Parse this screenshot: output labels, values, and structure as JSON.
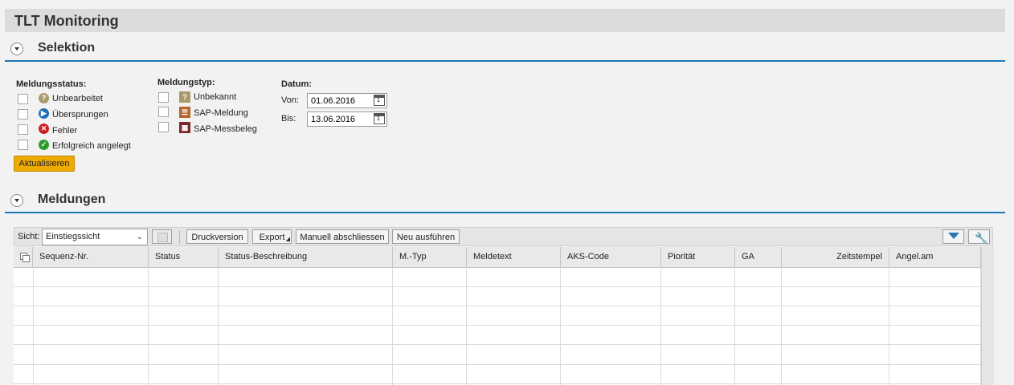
{
  "app": {
    "title": "TLT Monitoring"
  },
  "selektion": {
    "title": "Selektion",
    "status_group": {
      "title": "Meldungsstatus:",
      "options": [
        {
          "label": "Unbearbeitet",
          "icon": "question-icon"
        },
        {
          "label": "Übersprungen",
          "icon": "skip-icon"
        },
        {
          "label": "Fehler",
          "icon": "error-icon"
        },
        {
          "label": "Erfolgreich angelegt",
          "icon": "success-icon"
        }
      ]
    },
    "type_group": {
      "title": "Meldungstyp:",
      "options": [
        {
          "label": "Unbekannt",
          "icon": "question-icon"
        },
        {
          "label": "SAP-Meldung",
          "icon": "notification-icon"
        },
        {
          "label": "SAP-Messbeleg",
          "icon": "measurement-icon"
        }
      ]
    },
    "date_group": {
      "title": "Datum:",
      "from_label": "Von:",
      "from_value": "01.06.2016",
      "to_label": "Bis:",
      "to_value": "13.06.2016"
    },
    "refresh_label": "Aktualisieren"
  },
  "meldungen": {
    "title": "Meldungen",
    "toolbar": {
      "view_label": "Sicht:",
      "view_value": "Einstiegssicht",
      "print_label": "Druckversion",
      "export_label": "Export",
      "close_label": "Manuell abschliessen",
      "rerun_label": "Neu ausführen"
    },
    "columns": [
      "Sequenz-Nr.",
      "Status",
      "Status-Beschreibung",
      "M.-Typ",
      "Meldetext",
      "AKS-Code",
      "Piorität",
      "GA",
      "Zeitstempel",
      "Angel.am"
    ]
  },
  "colors": {
    "accent": "#1a79b5",
    "primary_button": "#f0ab00"
  }
}
